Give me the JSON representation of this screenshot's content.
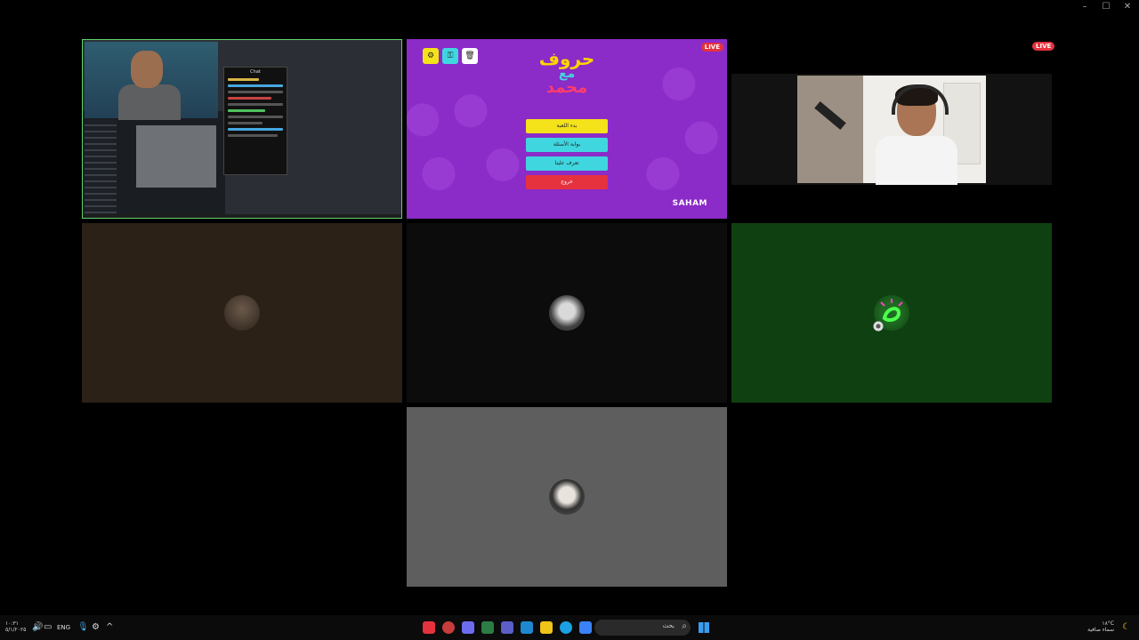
{
  "window_controls": {
    "minimize": "–",
    "maximize": "☐",
    "close": "✕"
  },
  "live_badge": "LIVE",
  "screen_share": {
    "chat_title": "Chat"
  },
  "game": {
    "logo_line1": "حروف",
    "logo_line2": "مع",
    "logo_line3": "محمد",
    "buttons": [
      {
        "label": "بدء اللعبة",
        "color": "#f4e21a"
      },
      {
        "label": "بوابة الأسئلة",
        "color": "#3fd6e0"
      },
      {
        "label": "تعرف علينا",
        "color": "#3fd6e0"
      },
      {
        "label": "خروج",
        "color": "#e5323e"
      }
    ],
    "tool_icons": [
      {
        "icon": "settings-icon",
        "glyph": "⚙",
        "color": "#f4e21a"
      },
      {
        "icon": "key-icon",
        "glyph": "⚿",
        "color": "#3fd6e0"
      },
      {
        "icon": "trash-icon",
        "glyph": "🗑",
        "color": "#ffffff"
      }
    ],
    "brand": "SAHAM",
    "brand_color": "#ffffff"
  },
  "taskbar": {
    "lang": "ENG",
    "search_placeholder": "بحث",
    "clock_time": "١٠:٣١",
    "clock_date": "٥/١/٢٠٢٥",
    "weather_temp": "١٨°C",
    "weather_desc": "سماء صافية"
  }
}
